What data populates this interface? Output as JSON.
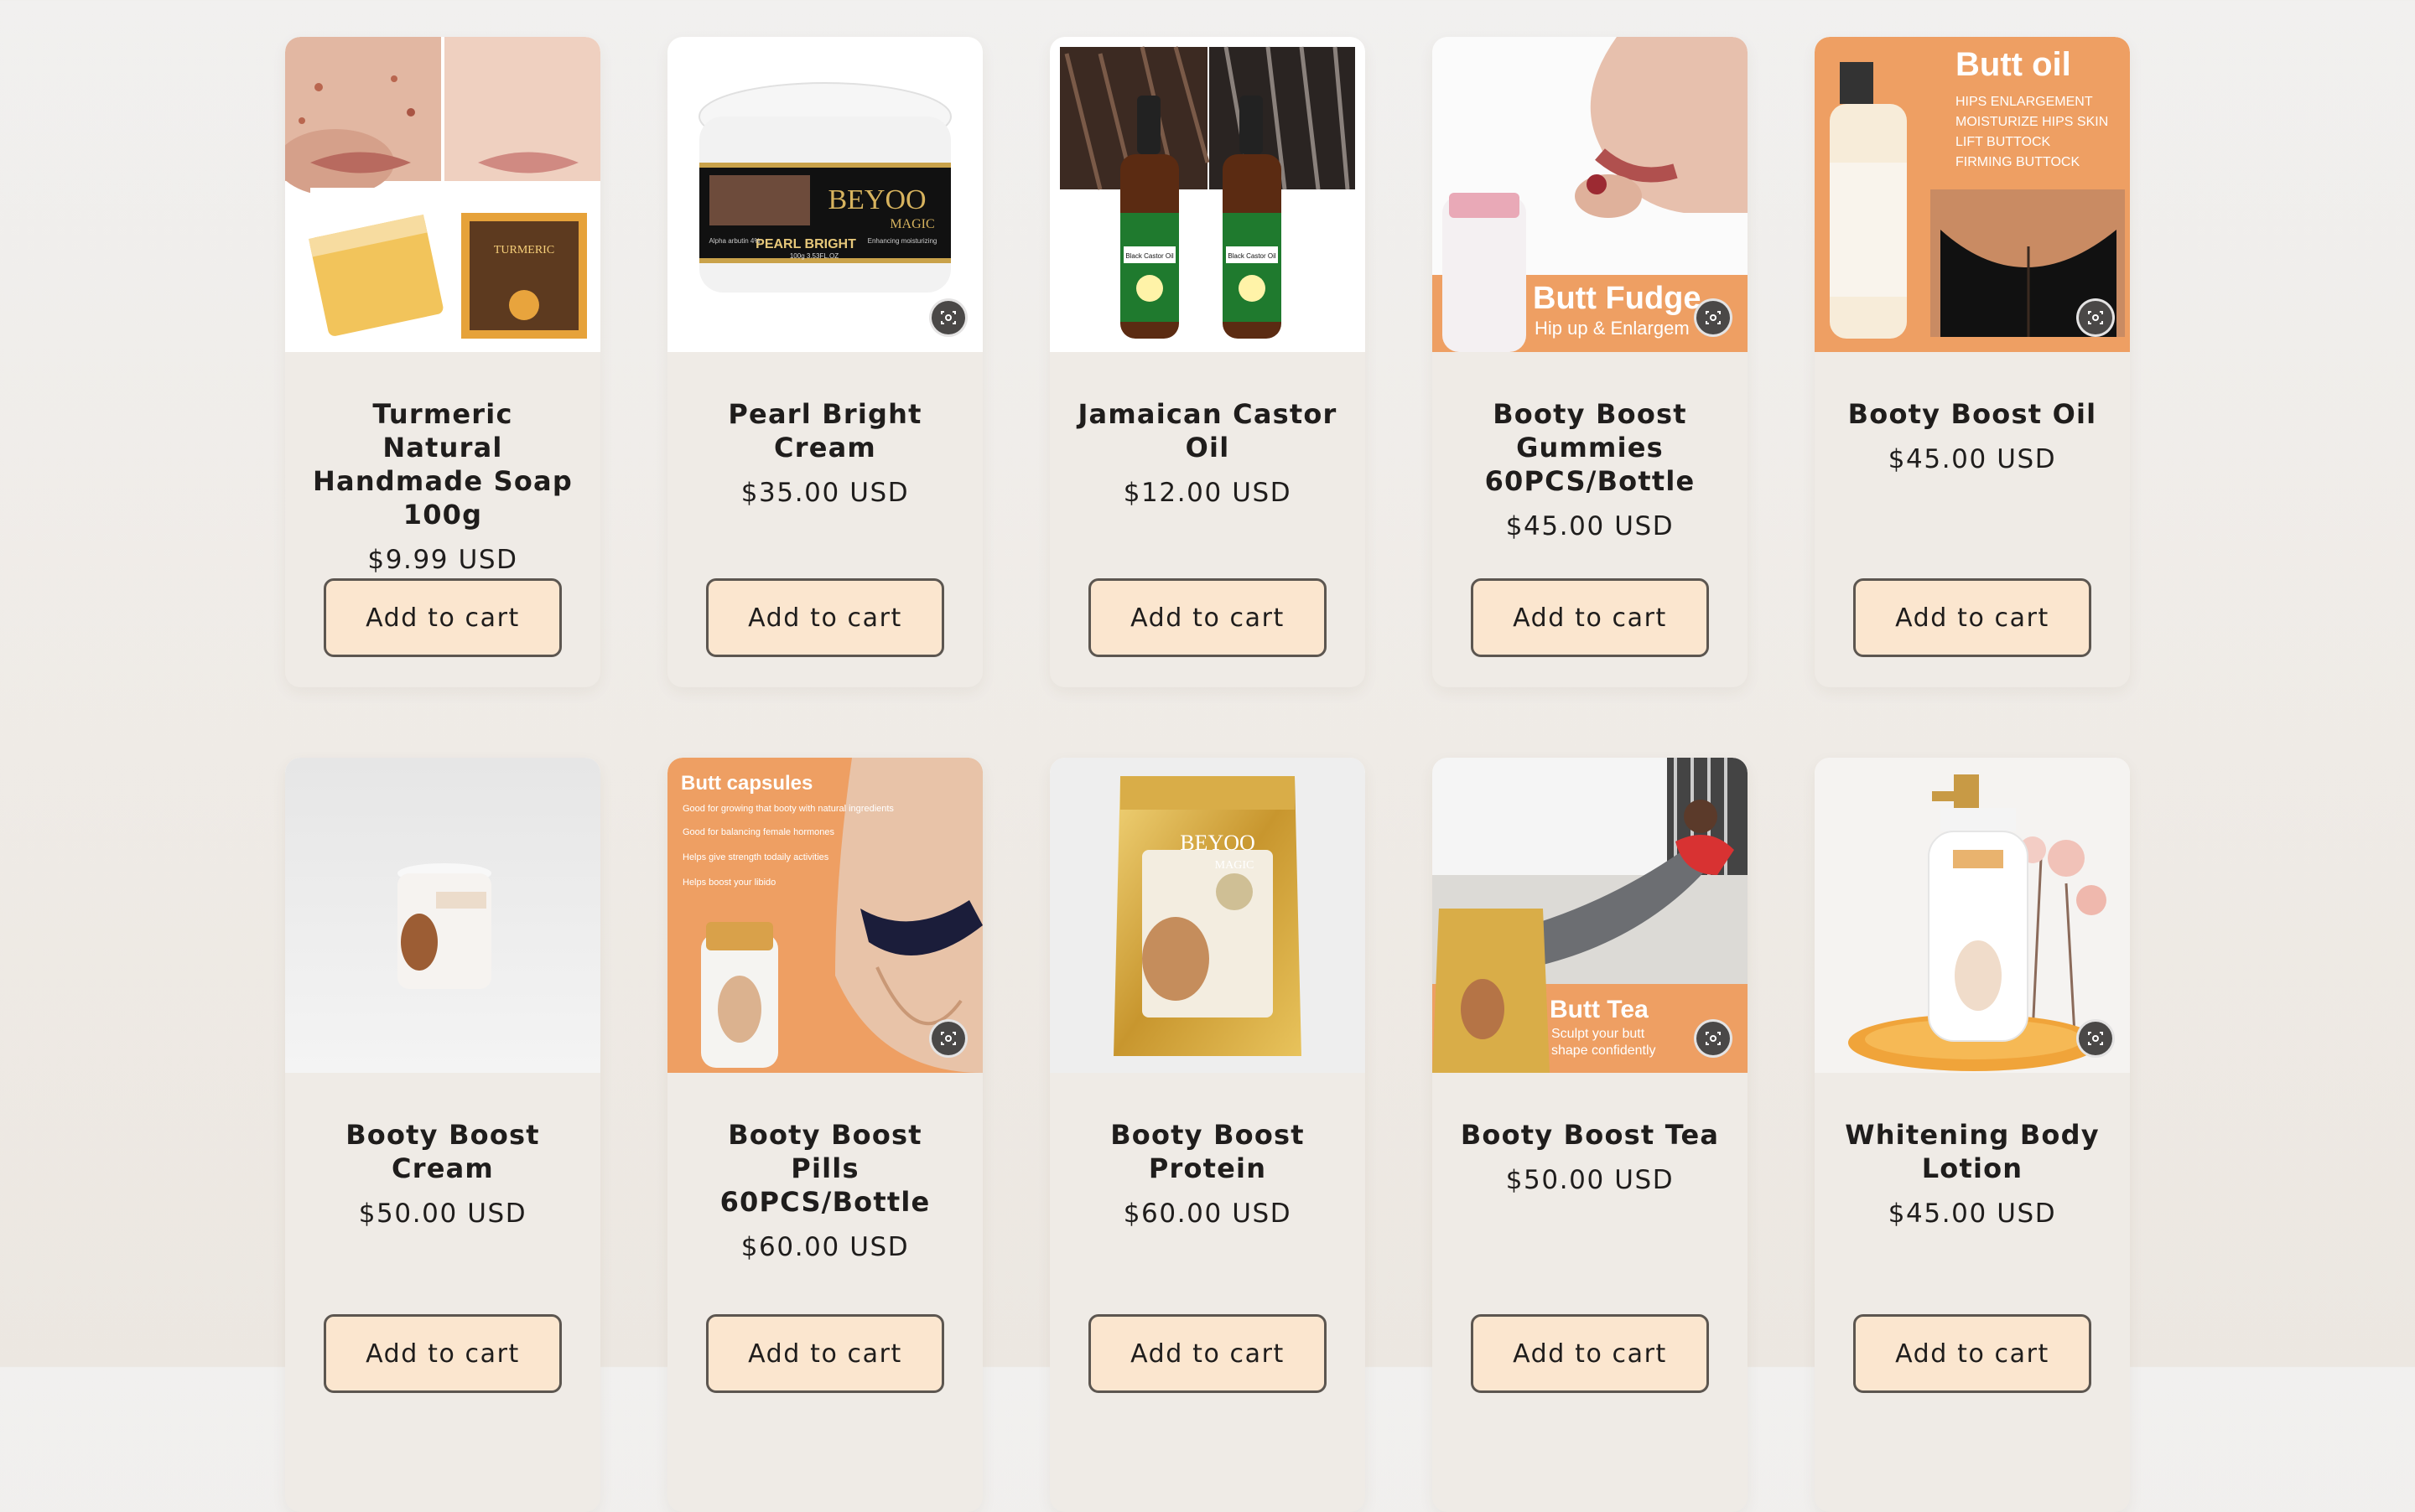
{
  "products": [
    {
      "title": "Turmeric Natural Handmade Soap 100g",
      "price": "$9.99 USD",
      "button": "Add to cart"
    },
    {
      "title": "Pearl Bright Cream",
      "price": "$35.00 USD",
      "button": "Add to cart",
      "image_text": {
        "brand": "BEYOO",
        "brand_sub": "MAGIC",
        "label": "PEARL BRIGHT",
        "line1": "Alpha arbutin 4%",
        "line2": "Enhancing moisturizing",
        "line3": "100g 3.53FL.OZ"
      }
    },
    {
      "title": "Jamaican Castor Oil",
      "price": "$12.00 USD",
      "button": "Add to cart",
      "image_text": {
        "label": "Black Castor Oil"
      }
    },
    {
      "title": "Booty Boost Gummies 60PCS/Bottle",
      "price": "$45.00 USD",
      "button": "Add to cart",
      "image_text": {
        "headline": "Butt Fudge",
        "sub": "Hip up & Enlargem"
      }
    },
    {
      "title": "Booty Boost Oil",
      "price": "$45.00 USD",
      "button": "Add to cart",
      "image_text": {
        "headline": "Butt oil",
        "l1": "HIPS ENLARGEMENT",
        "l2": "MOISTURIZE HIPS SKIN",
        "l3": "LIFT BUTTOCK",
        "l4": "FIRMING BUTTOCK"
      }
    },
    {
      "title": "Booty Boost Cream",
      "price": "$50.00 USD",
      "button": "Add to cart"
    },
    {
      "title": "Booty Boost Pills 60PCS/Bottle",
      "price": "$60.00 USD",
      "button": "Add to cart",
      "image_text": {
        "headline": "Butt capsules",
        "l1": "Good for growing that booty with natural ingredients",
        "l2": "Good for balancing female hormones",
        "l3": "Helps give strength todaily activities",
        "l4": "Helps boost your libido"
      }
    },
    {
      "title": "Booty Boost Protein",
      "price": "$60.00 USD",
      "button": "Add to cart",
      "image_text": {
        "brand": "BEYOO",
        "brand_sub": "MAGIC"
      }
    },
    {
      "title": "Booty Boost Tea",
      "price": "$50.00 USD",
      "button": "Add to cart",
      "image_text": {
        "headline": "Butt Tea",
        "l1": "Sculpt your butt",
        "l2": "shape confidently"
      }
    },
    {
      "title": "Whitening Body Lotion",
      "price": "$45.00 USD",
      "button": "Add to cart"
    }
  ],
  "colors": {
    "card": "#efebe6",
    "button_bg": "#fbe6cf",
    "button_border": "#5c5650",
    "accent_orange": "#ee9f63"
  }
}
